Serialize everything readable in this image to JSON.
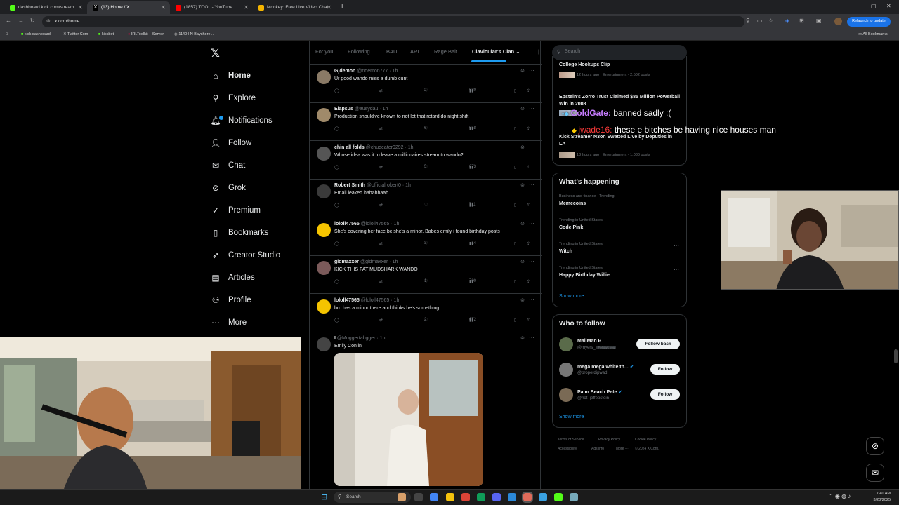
{
  "browser": {
    "tabs": [
      {
        "title": "dashboard.kick.com/stream",
        "color": "#53fc18"
      },
      {
        "title": "(13) Home / X",
        "color": "#ffffff"
      },
      {
        "title": "(1857) TOOL - YouTube",
        "color": "#ff0000"
      },
      {
        "title": "Monkey: Free Live Video Chat",
        "color": "#f4b400"
      }
    ],
    "new_tab": "+",
    "url": "x.com/home",
    "relaunch": "Relaunch to update",
    "bookmarks": [
      "kick dashboard",
      "Twitter Com",
      "kickbot",
      "IRLToolkit + Server",
      "11404 N Bayshore..."
    ],
    "all_bookmarks": "All Bookmarks"
  },
  "x": {
    "logo": "𝕏",
    "nav": [
      {
        "label": "Home",
        "icon": "home-icon",
        "glyph": "⌂"
      },
      {
        "label": "Explore",
        "icon": "search-icon",
        "glyph": "⚲"
      },
      {
        "label": "Notifications",
        "icon": "bell-icon",
        "glyph": "🔔︎",
        "badge": "13"
      },
      {
        "label": "Follow",
        "icon": "person-add-icon",
        "glyph": "👤︎"
      },
      {
        "label": "Chat",
        "icon": "message-icon",
        "glyph": "✉"
      },
      {
        "label": "Grok",
        "icon": "grok-icon",
        "glyph": "⊘"
      },
      {
        "label": "Premium",
        "icon": "premium-icon",
        "glyph": "✓"
      },
      {
        "label": "Bookmarks",
        "icon": "bookmark-icon",
        "glyph": "▯"
      },
      {
        "label": "Creator Studio",
        "icon": "rocket-icon",
        "glyph": "➶"
      },
      {
        "label": "Articles",
        "icon": "articles-icon",
        "glyph": "▤"
      },
      {
        "label": "Profile",
        "icon": "profile-icon",
        "glyph": "⚇"
      },
      {
        "label": "More",
        "icon": "more-icon",
        "glyph": "⋯"
      }
    ],
    "timeline_tabs": [
      "For you",
      "Following",
      "BAU",
      "ARL",
      "Rage Bait",
      "Clavicular's Clan"
    ],
    "tweets": [
      {
        "name": "Gjdemon",
        "handle": "@ndemon777 · 1h",
        "text": "Ur good wando miss a dumb cunt",
        "likes": "2",
        "views": "630",
        "avatar": "#8a7a66"
      },
      {
        "name": "Elapsus",
        "handle": "@ausydau · 1h",
        "text": "Production should've known to not let that retard do night shift",
        "likes": "6",
        "views": "658",
        "avatar": "#a08a6a"
      },
      {
        "name": "chin all folds",
        "handle": "@chudeater9292 · 1h",
        "text": "Whose idea was it to leave a millionaires stream to wando?",
        "likes": "5",
        "views": "673",
        "avatar": "#555555"
      },
      {
        "name": "Robert Smith",
        "handle": "@officialrobert0 · 1h",
        "text": "Email leaked hahahhaah",
        "likes": "",
        "views": "711",
        "avatar": "#3a3a3a"
      },
      {
        "name": "lololl47565",
        "handle": "@lololl47565 · 1h",
        "text": "She's covering her face bc she's a minor. Babes emily i found birthday posts",
        "likes": "3",
        "views": "714",
        "avatar": "#f5c400"
      },
      {
        "name": "gldmaxxer",
        "handle": "@gldmaxxer · 1h",
        "text": "KICK THIS FAT MUDSHARK WANDO",
        "likes": "1",
        "views": "700",
        "avatar": "#7b5a5a"
      },
      {
        "name": "lololl47565",
        "handle": "@lololl47565 · 1h",
        "text": "bro has a minor there and thinks he's something",
        "likes": "2",
        "views": "672",
        "avatar": "#f5c400"
      },
      {
        "name": "I",
        "handle": "@Moggertabgger · 1h",
        "text": "Emily Conlin",
        "likes": "",
        "views": "",
        "avatar": "#444444"
      }
    ],
    "search_placeholder": "Search",
    "trending_top": [
      {
        "name": "College Hookups Clip",
        "meta": "12 hours ago · Entertainment · 2,502 posts"
      },
      {
        "name": "Epstein's Zorro Trust Claimed $85 Million Powerball Win in 2008",
        "meta": ""
      },
      {
        "name": "Kick Streamer N3on Swatted Live by Deputies in LA",
        "meta": "13 hours ago · Entertainment · 1,080 posts"
      }
    ],
    "whats_happening": {
      "title": "What's happening",
      "items": [
        {
          "meta": "Business and finance · Trending",
          "name": "Memecoins"
        },
        {
          "meta": "Trending in United States",
          "name": "Code Pink"
        },
        {
          "meta": "Trending in United States",
          "name": "Witch"
        },
        {
          "meta": "Trending in United States",
          "name": "Happy Birthday Willie"
        }
      ],
      "show_more": "Show more"
    },
    "who_to_follow": {
      "title": "Who to follow",
      "items": [
        {
          "name": "MailMan P",
          "handle": "@myers_",
          "button": "Follow back",
          "tag": "Follows you"
        },
        {
          "name": "mega mega white th...",
          "handle": "@properdipwad",
          "button": "Follow",
          "tag": ""
        },
        {
          "name": "Palm Beach Pete",
          "handle": "@not_jeffepstein",
          "button": "Follow",
          "tag": ""
        }
      ],
      "show_more": "Show more"
    },
    "footer": [
      "Terms of Service",
      "Privacy Policy",
      "Cookie Policy",
      "Accessibility",
      "Ads info",
      "More ···",
      "© 2024 X Corp."
    ]
  },
  "stream_chat": [
    {
      "user": "ColdGate:",
      "message": "banned sadly :(",
      "color": "#c77dff"
    },
    {
      "user": "jwade16:",
      "message": "these e bitches be having nice houses man",
      "color": "#ff3b3b"
    }
  ],
  "taskbar": {
    "search": "Search",
    "time": "7:40 AM",
    "date": "3/23/2025"
  }
}
